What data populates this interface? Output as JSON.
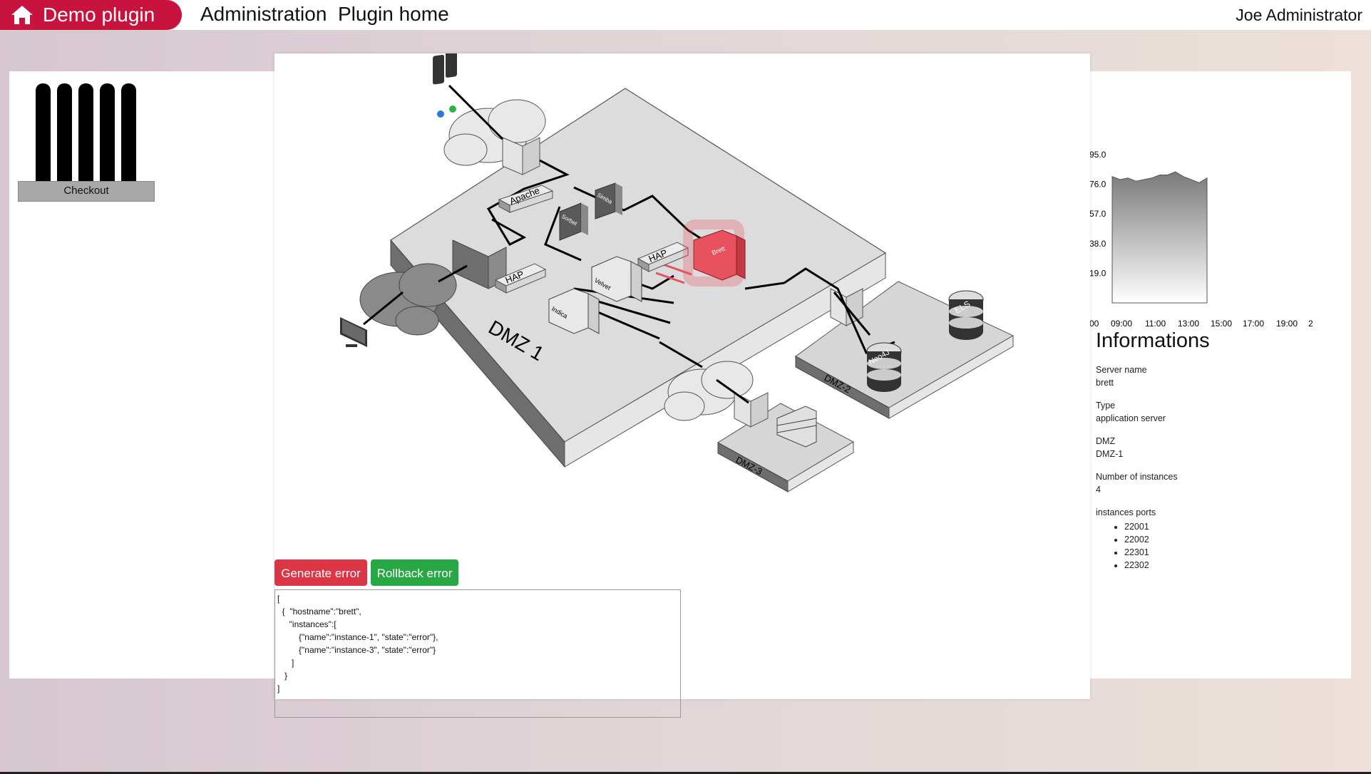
{
  "topbar": {
    "brand": "Demo plugin",
    "nav": [
      "Administration",
      "Plugin home"
    ],
    "user": "Joe Administrator"
  },
  "left": {
    "checkout_label": "Checkout"
  },
  "diagram": {
    "labels": {
      "apache": "Apache",
      "hap1": "HAP",
      "hap2": "HAP",
      "dmz1": "DMZ 1",
      "dmz2": "DMZ-2",
      "dmz3": "DMZ-3",
      "els": "ELS",
      "neo4j": "Neo4J",
      "brett": "Brett",
      "velvet": "Velvet",
      "indica": "Indica",
      "simba": "Simba",
      "sorbet": "Sorbet"
    },
    "highlight_color": "#e8525e"
  },
  "actions": {
    "generate_error": "Generate error",
    "rollback_error": "Rollback error",
    "json_text": "[\n  {  \"hostname\":\"brett\",\n     \"instances\":[\n         {\"name\":\"instance-1\", \"state\":\"error\"},\n         {\"name\":\"instance-3\", \"state\":\"error\"}\n      ]\n   }\n]"
  },
  "chart_data": {
    "type": "area",
    "y_ticks": [
      "95.0",
      "76.0",
      "57.0",
      "38.0",
      "19.0"
    ],
    "x_ticks": [
      "00",
      "09:00",
      "11:00",
      "13:00",
      "15:00",
      "17:00",
      "19:00",
      "2"
    ],
    "ylim": [
      0,
      95
    ],
    "x": [
      "09:00",
      "09:30",
      "10:00",
      "10:30",
      "11:00",
      "11:30",
      "12:00",
      "12:30",
      "13:00",
      "13:30",
      "14:00",
      "14:30",
      "14:45"
    ],
    "values": [
      81,
      79,
      80,
      78,
      79,
      80,
      82,
      82,
      84,
      81,
      79,
      77,
      80
    ]
  },
  "info": {
    "title": "Informations",
    "fields": [
      {
        "label": "Server name",
        "value": "brett"
      },
      {
        "label": "Type",
        "value": "application server"
      },
      {
        "label": "DMZ",
        "value": "DMZ-1"
      },
      {
        "label": "Number of instances",
        "value": "4"
      }
    ],
    "ports_label": "instances ports",
    "ports": [
      "22001",
      "22002",
      "22301",
      "22302"
    ]
  }
}
